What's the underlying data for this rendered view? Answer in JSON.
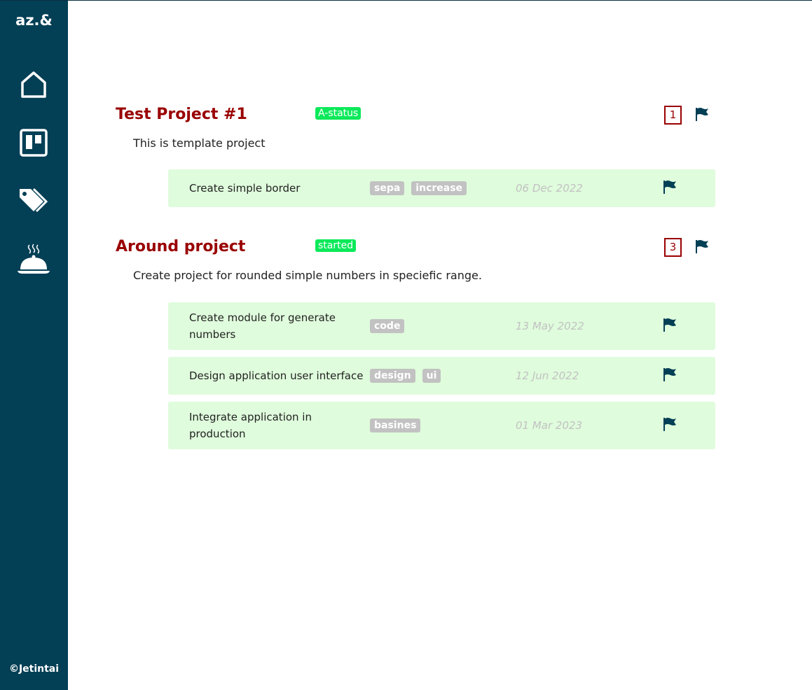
{
  "sidebar": {
    "logo": "az.&",
    "items": [
      "home",
      "boards",
      "tags",
      "dishes"
    ],
    "copyright": "©Jetintai"
  },
  "projects": [
    {
      "title": "Test Project #1",
      "status": "A-status",
      "count": "1",
      "description": "This is template project",
      "tasks": [
        {
          "name": "Create simple border",
          "tags": [
            "sepa",
            "increase"
          ],
          "date": "06 Dec 2022"
        }
      ]
    },
    {
      "title": "Around project",
      "status": "started",
      "count": "3",
      "description": "Create project for rounded simple numbers in speciefic range.",
      "tasks": [
        {
          "name": "Create module for generate numbers",
          "tags": [
            "code"
          ],
          "date": "13 May 2022"
        },
        {
          "name": "Design application user interface",
          "tags": [
            "design",
            "ui"
          ],
          "date": "12 Jun 2022"
        },
        {
          "name": "Integrate application in production",
          "tags": [
            "basines"
          ],
          "date": "01 Mar 2023"
        }
      ]
    }
  ],
  "colors": {
    "sidebar": "#033f55",
    "title": "#990000",
    "status": "#0ce95a",
    "task_bg": "#dffcdc",
    "tag": "#c2c2c2"
  }
}
